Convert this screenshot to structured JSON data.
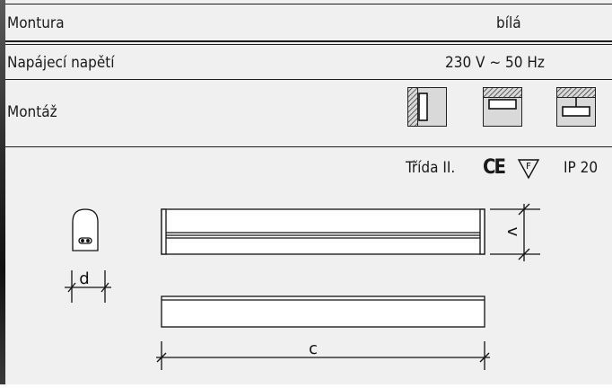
{
  "rows": {
    "montura": {
      "label": "Montura",
      "value": "bílá"
    },
    "napeti": {
      "label": "Napájecí napětí",
      "value": "230 V ~ 50 Hz"
    },
    "montaz": {
      "label": "Montáž",
      "icons": [
        "wall-mount-icon",
        "ceiling-mount-flush-icon",
        "ceiling-mount-suspended-icon"
      ]
    },
    "trida": {
      "class_label": "Třída II.",
      "ce_mark": "CE",
      "f_mark": "F",
      "ip_rating": "IP 20"
    }
  },
  "drawing": {
    "dimension_d": "d",
    "dimension_v": "v",
    "dimension_c": "c"
  }
}
